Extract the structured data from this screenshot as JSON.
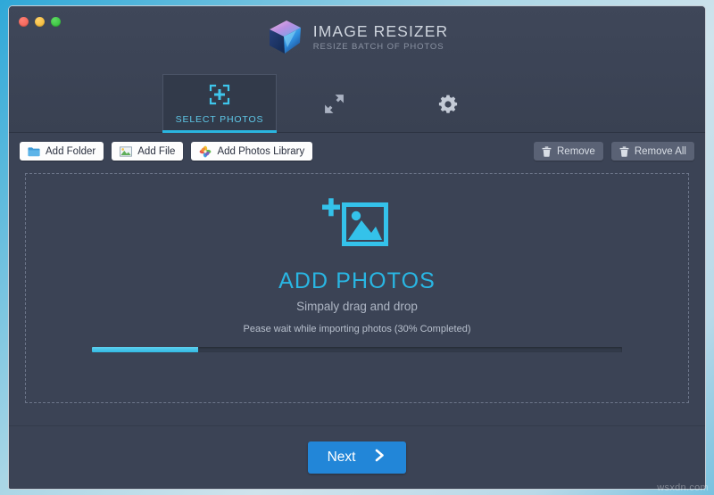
{
  "window": {
    "traffic_lights": [
      {
        "name": "close",
        "color": "#ef5b50"
      },
      {
        "name": "minimize",
        "color": "#f0b42c"
      },
      {
        "name": "maximize",
        "color": "#2cba34"
      }
    ]
  },
  "brand": {
    "title": "IMAGE RESIZER",
    "subtitle": "RESIZE BATCH OF PHOTOS",
    "logo_icon": "gem-logo-icon",
    "logo_colors": [
      "#e9a8d8",
      "#b58ce0",
      "#3fb6ea",
      "#1b3a6e"
    ]
  },
  "tabs": [
    {
      "label": "SELECT PHOTOS",
      "icon": "select-photos-icon",
      "active": true
    },
    {
      "label": "",
      "icon": "resize-arrows-icon",
      "active": false
    },
    {
      "label": "",
      "icon": "gear-icon",
      "active": false
    }
  ],
  "toolbar": {
    "left_buttons": [
      {
        "label": "Add Folder",
        "icon": "folder-icon"
      },
      {
        "label": "Add File",
        "icon": "image-file-icon"
      },
      {
        "label": "Add Photos Library",
        "icon": "photos-library-icon"
      }
    ],
    "right_buttons": [
      {
        "label": "Remove",
        "icon": "trash-icon"
      },
      {
        "label": "Remove All",
        "icon": "trash-icon"
      }
    ]
  },
  "dropzone": {
    "icon": "add-photos-icon",
    "title": "ADD PHOTOS",
    "subtitle": "Simpaly drag and drop",
    "progress": {
      "label": "Pease wait while importing photos (30% Completed)",
      "percent": 20,
      "percent_text": "30% Completed",
      "fill_color": "#31b9e4"
    }
  },
  "footer": {
    "next_label": "Next",
    "next_icon": "chevron-right-icon",
    "next_color": "#2286d8"
  },
  "watermark": "wsxdn.com",
  "theme": {
    "window_bg": "#3b4355",
    "header_bg": "#3f4759",
    "accent": "#29b6e3",
    "tab_active_bg": "#323a4a",
    "dashed_border": "#6d768a"
  }
}
